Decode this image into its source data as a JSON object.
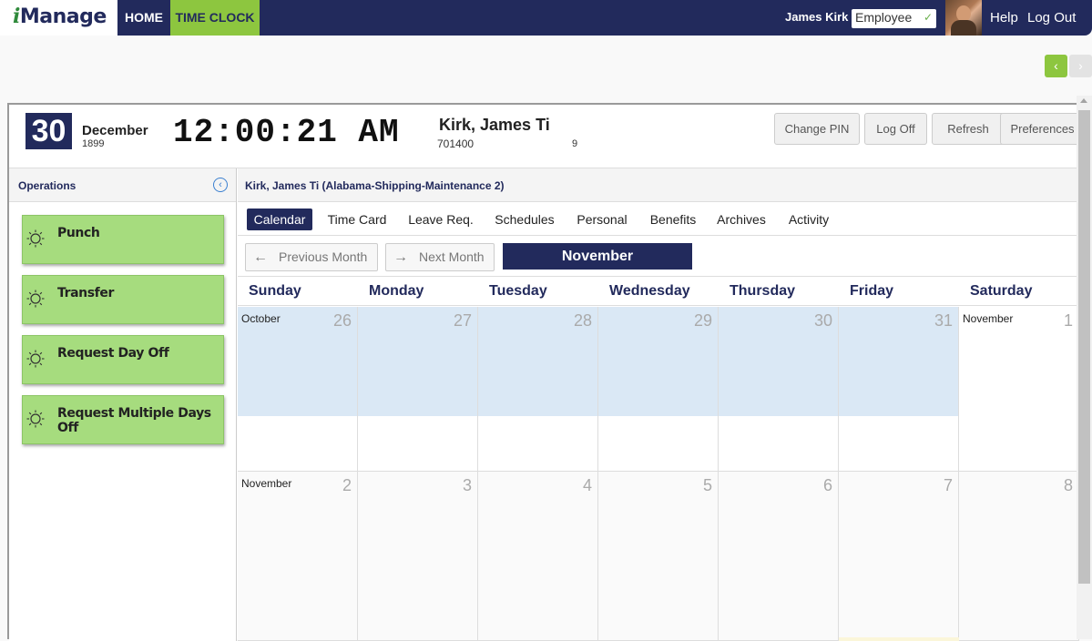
{
  "brand": {
    "i": "i",
    "rest": "Manage"
  },
  "nav": {
    "home": "HOME",
    "timeclock": "TIME CLOCK"
  },
  "user": {
    "name": "James Kirk",
    "role": "Employee",
    "help": "Help",
    "logout": "Log Out"
  },
  "pager": {
    "prev": "‹",
    "next": "›"
  },
  "header": {
    "day": "30",
    "month": "December",
    "year": "1899",
    "time": "12:00:21 AM",
    "employee_name": "Kirk, James Ti",
    "employee_id": "701400",
    "employee_num": "9",
    "buttons": {
      "change_pin": "Change PIN",
      "log_off": "Log Off",
      "refresh": "Refresh",
      "preferences": "Preferences"
    }
  },
  "sidebar": {
    "title": "Operations",
    "collapse": "‹",
    "operations": [
      "Punch",
      "Transfer",
      "Request Day Off",
      "Request Multiple Days Off"
    ]
  },
  "content": {
    "breadcrumb": "Kirk, James Ti (Alabama-Shipping-Maintenance 2)",
    "tabs": [
      "Calendar",
      "Time Card",
      "Leave Req.",
      "Schedules",
      "Personal",
      "Benefits",
      "Archives",
      "Activity"
    ],
    "active_tab": "Calendar",
    "prev_month": "Previous Month",
    "next_month": "Next Month",
    "prev_arrow": "←",
    "next_arrow": "→",
    "month_title": "November"
  },
  "calendar": {
    "weekdays": [
      "Sunday",
      "Monday",
      "Tuesday",
      "Wednesday",
      "Thursday",
      "Friday",
      "Saturday"
    ],
    "week1": [
      {
        "label": "October",
        "day": "26",
        "highlight": true
      },
      {
        "label": "",
        "day": "27",
        "highlight": true
      },
      {
        "label": "",
        "day": "28",
        "highlight": true
      },
      {
        "label": "",
        "day": "29",
        "highlight": true
      },
      {
        "label": "",
        "day": "30",
        "highlight": true
      },
      {
        "label": "",
        "day": "31",
        "highlight": true
      },
      {
        "label": "November",
        "day": "1",
        "highlight": false
      }
    ],
    "week2": [
      {
        "label": "November",
        "day": "2",
        "highlight": false
      },
      {
        "label": "",
        "day": "3",
        "highlight": false
      },
      {
        "label": "",
        "day": "4",
        "highlight": false
      },
      {
        "label": "",
        "day": "5",
        "highlight": false
      },
      {
        "label": "",
        "day": "6",
        "highlight": false
      },
      {
        "label": "",
        "day": "7",
        "highlight": false
      },
      {
        "label": "",
        "day": "8",
        "highlight": false
      }
    ],
    "colors": {
      "highlight": "#dae8f5",
      "today_strip": "#fbf6d9"
    }
  },
  "colors": {
    "navy": "#222a5c",
    "green": "#8dc63f",
    "op_green": "#a6dc7e"
  }
}
